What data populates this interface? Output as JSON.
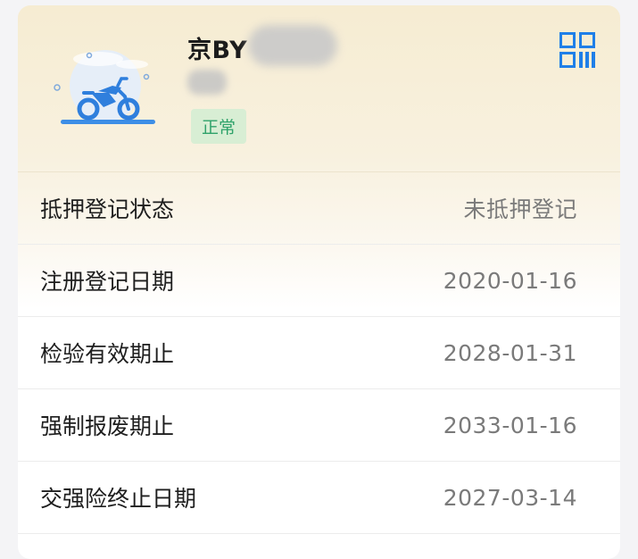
{
  "vehicle": {
    "plate_prefix": "京BY",
    "status": "正常"
  },
  "icons": {
    "illustration": "motorcycle-icon",
    "qr": "qr-code-icon"
  },
  "colors": {
    "accent_blue": "#1f7fe8",
    "status_green": "#2fa26a",
    "status_bg": "#d8eed4"
  },
  "details": [
    {
      "label": "抵押登记状态",
      "value": "未抵押登记"
    },
    {
      "label": "注册登记日期",
      "value": "2020-01-16"
    },
    {
      "label": "检验有效期止",
      "value": "2028-01-31"
    },
    {
      "label": "强制报废期止",
      "value": "2033-01-16"
    },
    {
      "label": "交强险终止日期",
      "value": "2027-03-14"
    }
  ]
}
